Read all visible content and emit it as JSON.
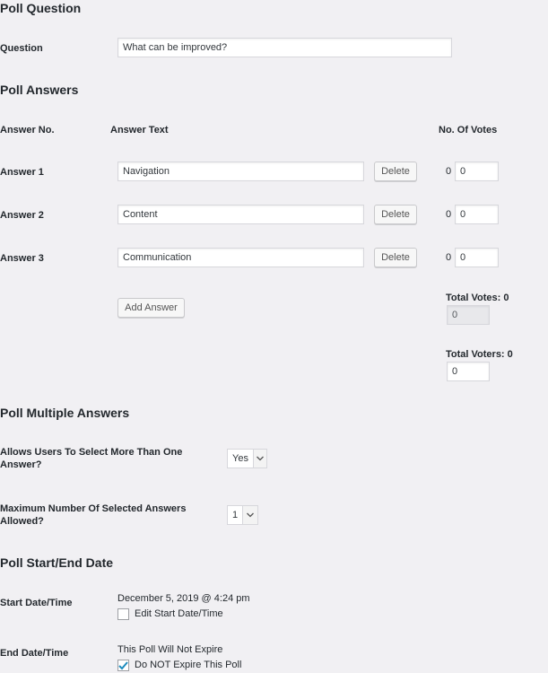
{
  "poll_question": {
    "title": "Poll Question",
    "question_label": "Question",
    "question_value": "What can be improved?"
  },
  "poll_answers": {
    "title": "Poll Answers",
    "col_answer_no": "Answer No.",
    "col_answer_text": "Answer Text",
    "col_votes": "No. Of Votes",
    "delete_label": "Delete",
    "answers": [
      {
        "label": "Answer 1",
        "text": "Navigation",
        "votes_prefix": "0",
        "votes": "0"
      },
      {
        "label": "Answer 2",
        "text": "Content",
        "votes_prefix": "0",
        "votes": "0"
      },
      {
        "label": "Answer 3",
        "text": "Communication",
        "votes_prefix": "0",
        "votes": "0"
      }
    ],
    "add_answer_label": "Add Answer",
    "total_votes_label": "Total Votes: 0",
    "total_votes_value": "0",
    "total_voters_label": "Total Voters: 0",
    "total_voters_value": "0"
  },
  "poll_multiple": {
    "title": "Poll Multiple Answers",
    "allow_label": "Allows Users To Select More Than One Answer?",
    "allow_value": "Yes",
    "max_label": "Maximum Number Of Selected Answers Allowed?",
    "max_value": "1"
  },
  "poll_dates": {
    "title": "Poll Start/End Date",
    "start_label": "Start Date/Time",
    "start_value": "December 5, 2019 @ 4:24 pm",
    "edit_start_label": "Edit Start Date/Time",
    "end_label": "End Date/Time",
    "end_value": "This Poll Will Not Expire",
    "no_expire_label": "Do NOT Expire This Poll"
  },
  "colors": {
    "background": "#f1f0f3",
    "checkmark": "#1e8cbe"
  }
}
